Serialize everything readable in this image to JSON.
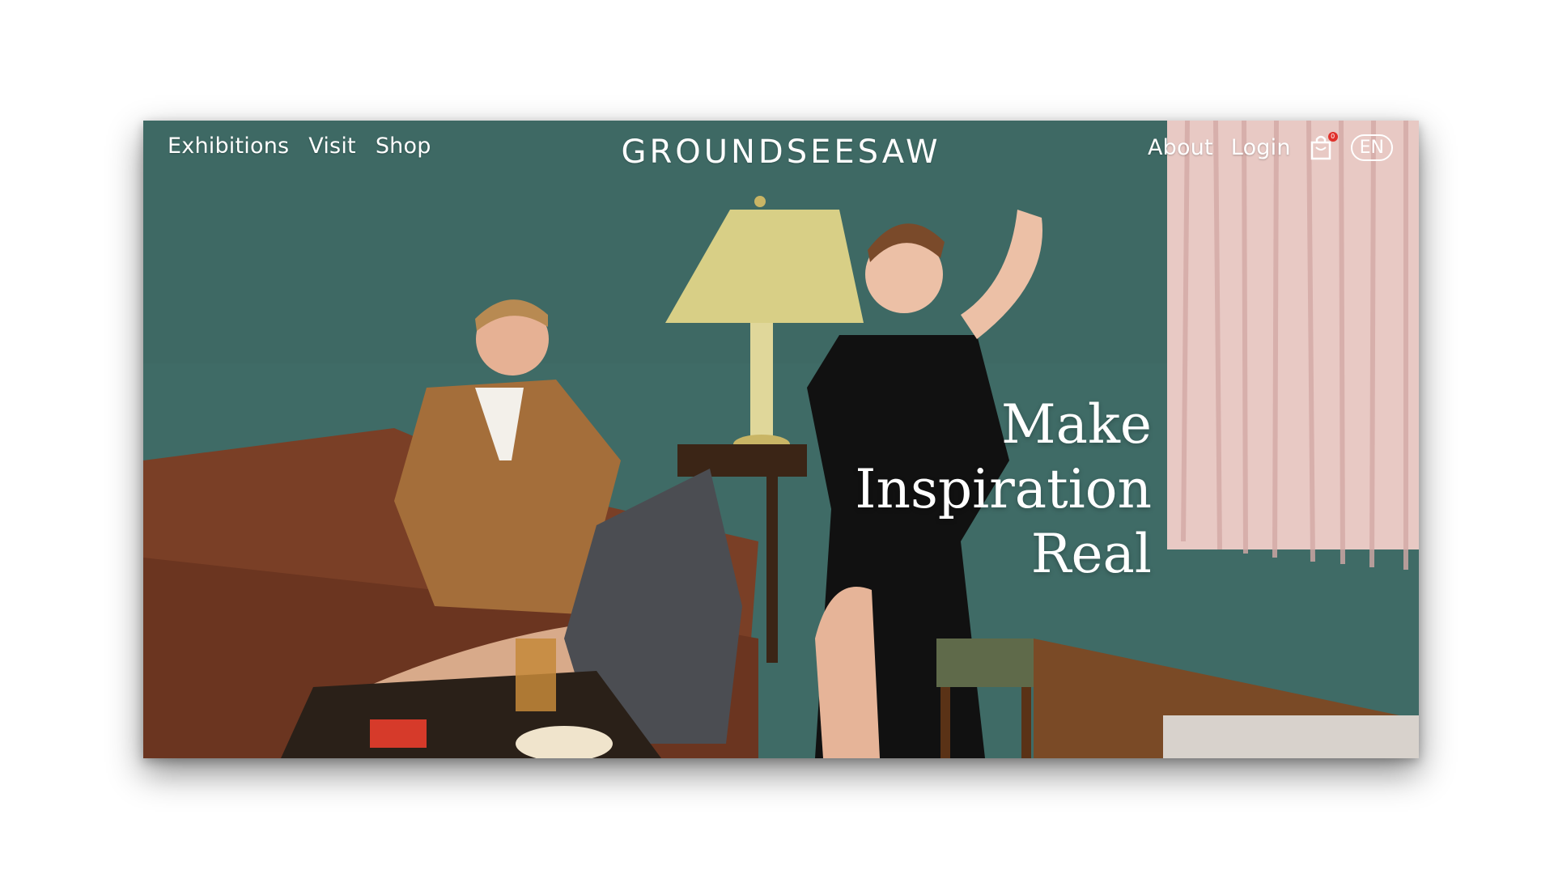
{
  "nav": {
    "left": [
      "Exhibitions",
      "Visit",
      "Shop"
    ],
    "right": [
      "About",
      "Login"
    ]
  },
  "brand": "GROUNDSEESAW",
  "cart": {
    "count": "0"
  },
  "language": "EN",
  "hero": {
    "headline": [
      "Make",
      "Inspiration",
      "Real"
    ]
  },
  "colors": {
    "wall": "#3e6a65",
    "sofa": "#7a3f26",
    "text": "#ffffff",
    "badge": "#e0302a"
  }
}
